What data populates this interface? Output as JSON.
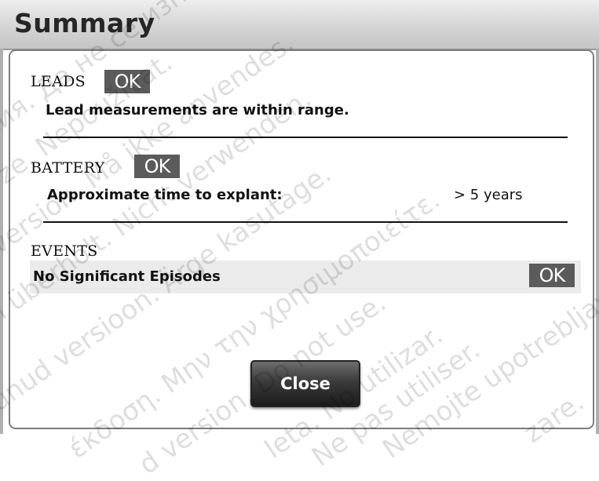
{
  "window": {
    "title": "Summary"
  },
  "sections": {
    "leads": {
      "label": "LEADS",
      "status": "OK",
      "message": "Lead measurements are within range."
    },
    "battery": {
      "label": "BATTERY",
      "status": "OK",
      "field_label": "Approximate time to explant:",
      "field_value": "> 5 years"
    },
    "events": {
      "label": "EVENTS",
      "message": "No Significant Episodes",
      "status": "OK"
    }
  },
  "actions": {
    "close_label": "Close"
  },
  "watermark_lines": [
    "сия. Да не се използва.",
    "erze. Nepoužívat.",
    "version. Må ikke anvendes.",
    "n überholt. Nicht verwenden.",
    "unud versioon. Ärge kasutage.",
    "έκδοση. Μην την χρησιμοποιείτε.",
    "d version. Do not use.",
    "leta. No utilizar.",
    "Ne pas utiliser.",
    "Nemojte upotrebljavati.",
    "zare."
  ],
  "colors": {
    "badge_bg": "#5b5b5b",
    "title_text": "#262626",
    "button_dark": "#1c1c1c"
  }
}
